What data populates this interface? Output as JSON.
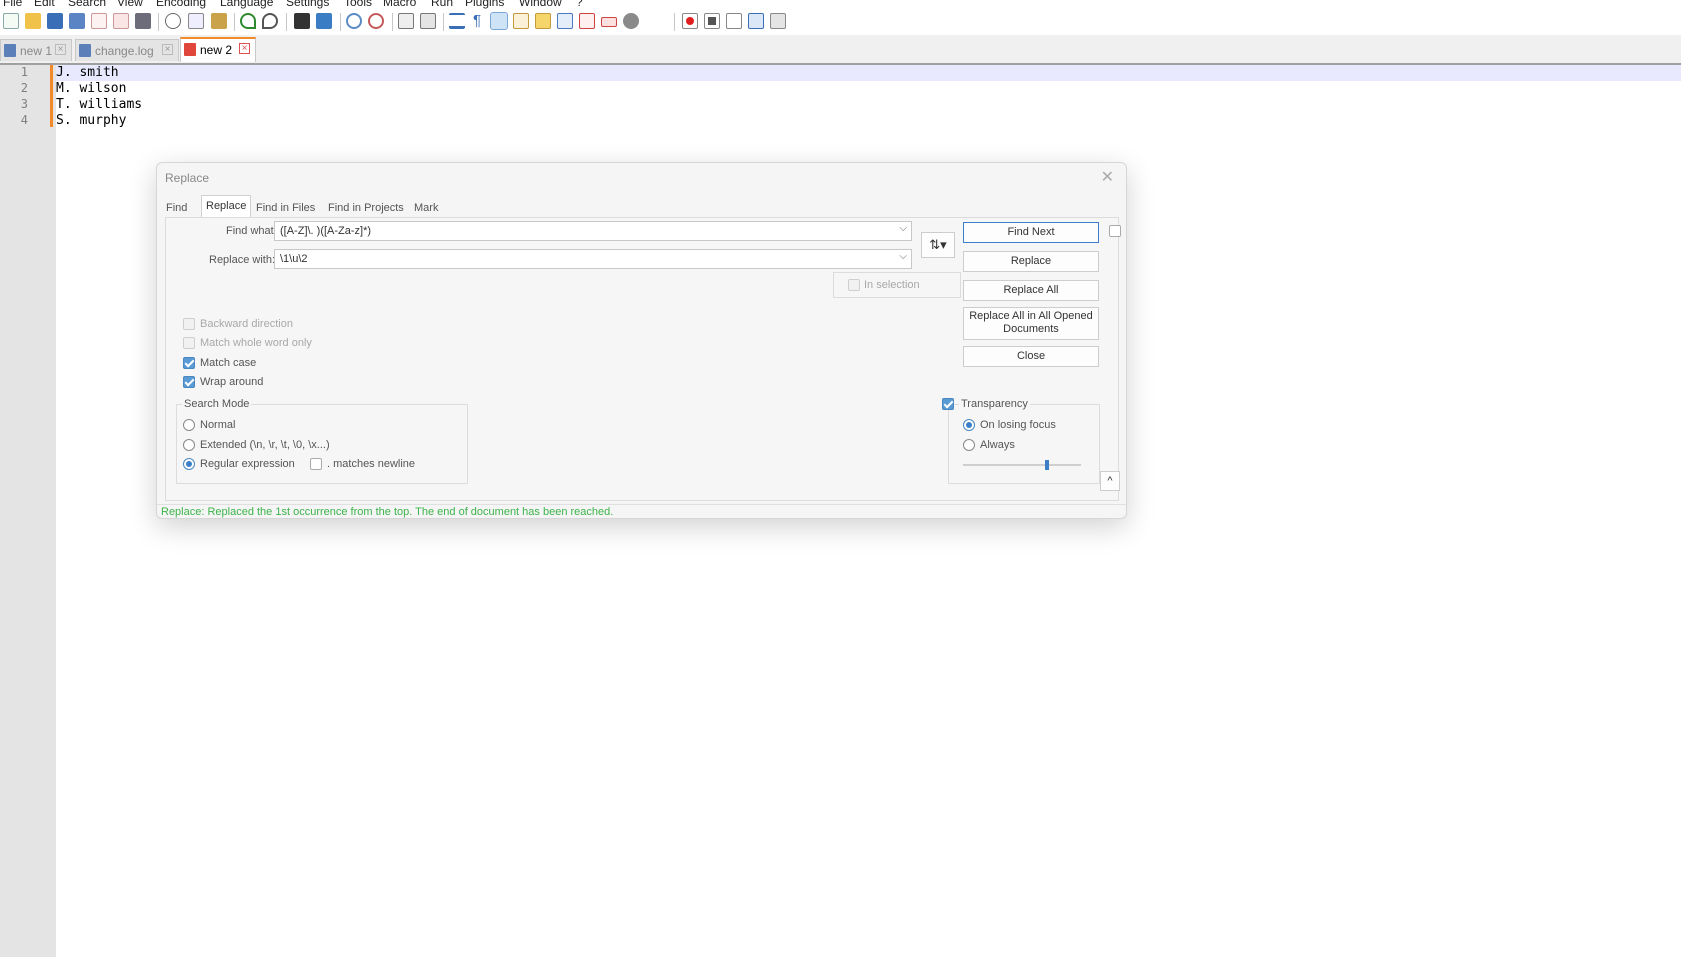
{
  "menu": [
    "File",
    "Edit",
    "Search",
    "View",
    "Encoding",
    "Language",
    "Settings",
    "Tools",
    "Macro",
    "Run",
    "Plugins",
    "Window",
    "?"
  ],
  "toolbar_icons": [
    "new-file-icon",
    "open-file-icon",
    "save-icon",
    "save-all-icon",
    "close-icon",
    "close-all-icon",
    "print-icon",
    "cut-icon",
    "copy-icon",
    "paste-icon",
    "undo-icon",
    "redo-icon",
    "find-icon",
    "replace-icon",
    "zoom-in-icon",
    "zoom-out-icon",
    "sync-vertical-icon",
    "sync-horizontal-icon",
    "word-wrap-icon",
    "show-all-chars-icon",
    "indent-guide-icon",
    "user-lang-icon",
    "doc-map-icon",
    "doc-list-icon",
    "function-list-icon",
    "folder-workspace-icon",
    "monitoring-icon",
    "record-macro-icon",
    "stop-record-icon",
    "play-macro-icon",
    "run-macro-multiple-icon",
    "save-macro-icon"
  ],
  "tabs": [
    {
      "label": "new 1",
      "active": false
    },
    {
      "label": "change.log",
      "active": false
    },
    {
      "label": "new 2",
      "active": true
    }
  ],
  "editor": {
    "lines": [
      {
        "num": "1",
        "text": "J. smith"
      },
      {
        "num": "2",
        "text": "M. wilson"
      },
      {
        "num": "3",
        "text": "T. williams"
      },
      {
        "num": "4",
        "text": "S. murphy"
      }
    ]
  },
  "dialog": {
    "title": "Replace",
    "tabs": [
      "Find",
      "Replace",
      "Find in Files",
      "Find in Projects",
      "Mark"
    ],
    "active_tab": "Replace",
    "find_label": "Find what:",
    "find_value": "([A-Z]\\. )([A-Za-z]*)",
    "replace_label": "Replace with:",
    "replace_value": "\\1\\u\\2",
    "swap_icon": "swap-arrows-icon",
    "buttons": {
      "find_next": "Find Next",
      "replace": "Replace",
      "replace_all": "Replace All",
      "replace_all_opened_1": "Replace All in All Opened",
      "replace_all_opened_2": "Documents",
      "close": "Close"
    },
    "in_selection": "In selection",
    "options": {
      "backward": "Backward direction",
      "whole_word": "Match whole word only",
      "match_case": "Match case",
      "wrap_around": "Wrap around"
    },
    "search_mode": {
      "title": "Search Mode",
      "normal": "Normal",
      "extended": "Extended (\\n, \\r, \\t, \\0, \\x...)",
      "regex": "Regular expression",
      "matches_newline": ". matches newline"
    },
    "transparency": {
      "title": "Transparency",
      "on_losing_focus": "On losing focus",
      "always": "Always",
      "slider_level": 0.72
    },
    "collapse_label": "^",
    "status": "Replace: Replaced the 1st occurrence from the top. The end of document has been reached."
  }
}
